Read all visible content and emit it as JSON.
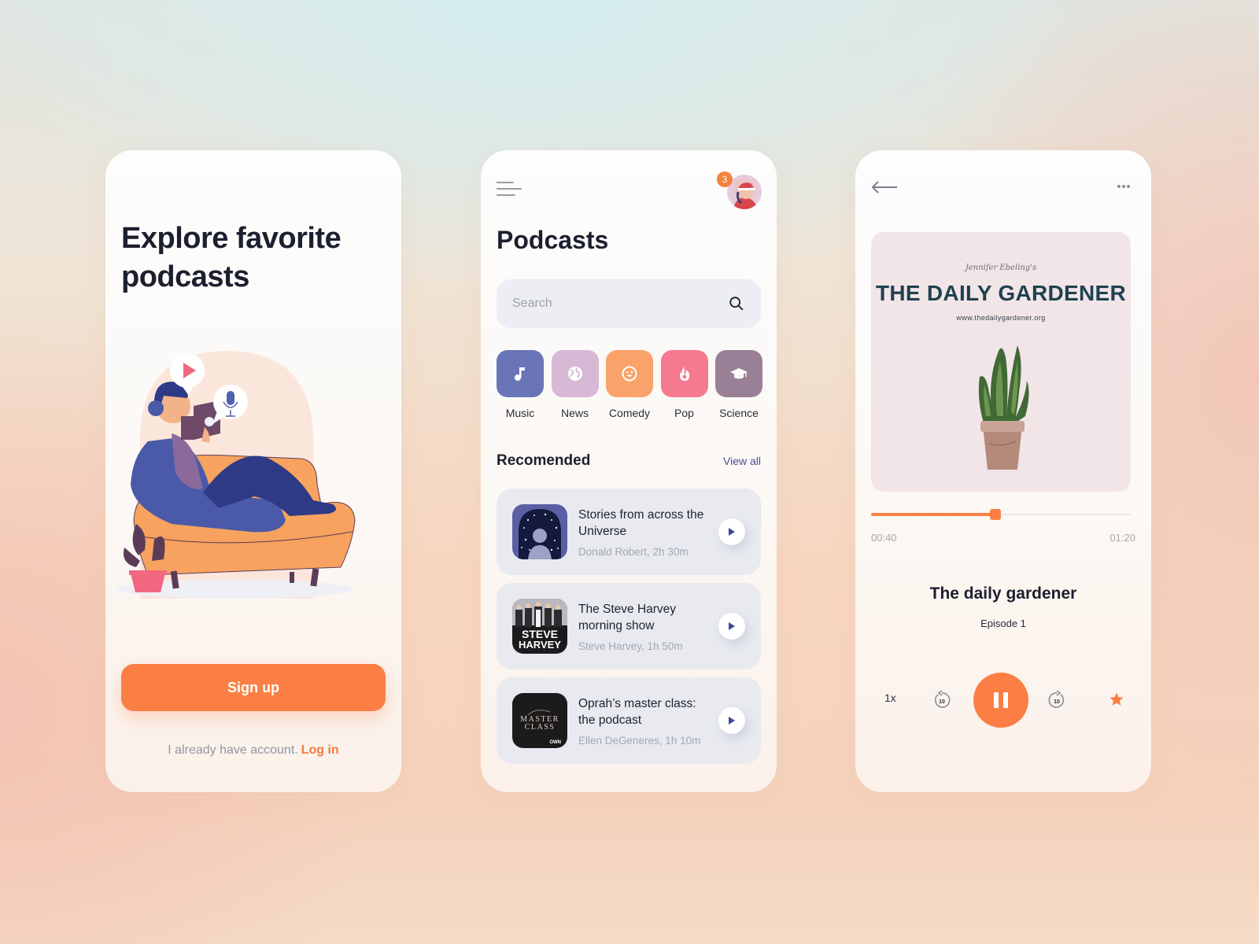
{
  "onboarding": {
    "headline": "Explore favorite podcasts",
    "signup_label": "Sign up",
    "login_prompt": "I already have account.",
    "login_link": "Log in"
  },
  "browse": {
    "notification_count": "3",
    "title": "Podcasts",
    "search": {
      "placeholder": "Search",
      "value": ""
    },
    "categories": [
      {
        "label": "Music",
        "icon": "music-note-icon",
        "color": "#6a75b8"
      },
      {
        "label": "News",
        "icon": "globe-icon",
        "color": "#d7b9d6"
      },
      {
        "label": "Comedy",
        "icon": "smiley-icon",
        "color": "#f9a26a"
      },
      {
        "label": "Pop",
        "icon": "flame-icon",
        "color": "#f67a8f"
      },
      {
        "label": "Science",
        "icon": "graduation-cap-icon",
        "color": "#9a8097"
      }
    ],
    "section_title": "Recomended",
    "view_all": "View all",
    "recommended": [
      {
        "title": "Stories from across the Universe",
        "meta": "Donald Robert, 2h 30m",
        "cover": "starry-portrait"
      },
      {
        "title": "The Steve Harvey morning show",
        "meta": "Steve Harvey, 1h 50m",
        "cover_text_1": "STEVE",
        "cover_text_2": "HARVEY"
      },
      {
        "title": "Oprah’s master class: the podcast",
        "meta": "Ellen DeGeneres, 1h 10m",
        "cover_text_1": "MASTER",
        "cover_text_2": "CLASS",
        "cover_badge": "OWN"
      }
    ]
  },
  "player": {
    "cover": {
      "script": "Jennifer Ebeling's",
      "title": "THE DAILY GARDENER",
      "url": "www.thedailygardener.org"
    },
    "progress": 0.48,
    "current_time": "00:40",
    "total_time": "01:20",
    "episode_title": "The daily gardener",
    "episode_sub": "Episode 1",
    "speed": "1x",
    "skip_seconds": "10",
    "accent": "#fb7f45"
  }
}
